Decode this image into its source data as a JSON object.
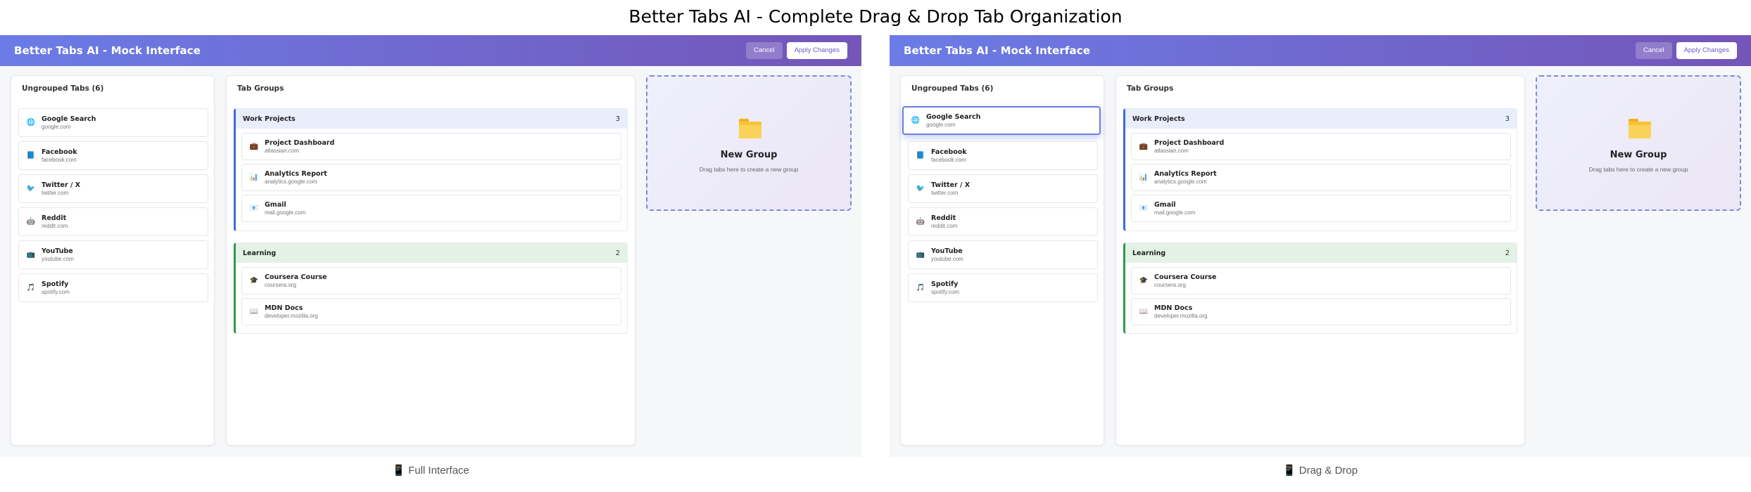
{
  "main_title": "Better Tabs AI - Complete Drag & Drop Tab Organization",
  "colors": {
    "header_start": "#6b7ce6",
    "header_end": "#7455b8",
    "work_group": "#3d6ad6",
    "learning_group": "#2f9a45",
    "drop_zone": "#7b8ae0"
  },
  "panels": [
    {
      "header": {
        "title": "Better Tabs AI - Mock Interface",
        "cancel_label": "Cancel",
        "apply_label": "Apply Changes"
      },
      "ungrouped": {
        "title": "Ungrouped Tabs (6)",
        "tabs": [
          {
            "name": "Google Search",
            "url": "google.com",
            "icon": "globe-icon",
            "glyph": "🌐"
          },
          {
            "name": "Facebook",
            "url": "facebook.com",
            "icon": "facebook-icon",
            "glyph": "📘"
          },
          {
            "name": "Twitter / X",
            "url": "twitter.com",
            "icon": "twitter-icon",
            "glyph": "🐦"
          },
          {
            "name": "Reddit",
            "url": "reddit.com",
            "icon": "reddit-icon",
            "glyph": "🤖"
          },
          {
            "name": "YouTube",
            "url": "youtube.com",
            "icon": "youtube-icon",
            "glyph": "📺"
          },
          {
            "name": "Spotify",
            "url": "spotify.com",
            "icon": "music-icon",
            "glyph": "🎵"
          }
        ]
      },
      "groups_title": "Tab Groups",
      "groups": [
        {
          "name": "Work Projects",
          "count": "3",
          "tabs": [
            {
              "name": "Project Dashboard",
              "url": "atlassian.com",
              "icon": "briefcase-icon",
              "glyph": "💼"
            },
            {
              "name": "Analytics Report",
              "url": "analytics.google.com",
              "icon": "chart-icon",
              "glyph": "📊"
            },
            {
              "name": "Gmail",
              "url": "mail.google.com",
              "icon": "mail-icon",
              "glyph": "📧"
            }
          ]
        },
        {
          "name": "Learning",
          "count": "2",
          "tabs": [
            {
              "name": "Coursera Course",
              "url": "coursera.org",
              "icon": "graduation-cap-icon",
              "glyph": "🎓"
            },
            {
              "name": "MDN Docs",
              "url": "developer.mozilla.org",
              "icon": "book-icon",
              "glyph": "📖"
            }
          ]
        }
      ],
      "new_group": {
        "title": "New Group",
        "subtitle": "Drag tabs here to create a new group"
      },
      "caption": "📱 Full Interface"
    },
    {
      "header": {
        "title": "Better Tabs AI - Mock Interface",
        "cancel_label": "Cancel",
        "apply_label": "Apply Changes"
      },
      "ungrouped": {
        "title": "Ungrouped Tabs (6)",
        "tabs": [
          {
            "name": "Google Search",
            "url": "google.com",
            "icon": "globe-icon",
            "glyph": "🌐",
            "dragging": true
          },
          {
            "name": "Facebook",
            "url": "facebook.com",
            "icon": "facebook-icon",
            "glyph": "📘"
          },
          {
            "name": "Twitter / X",
            "url": "twitter.com",
            "icon": "twitter-icon",
            "glyph": "🐦"
          },
          {
            "name": "Reddit",
            "url": "reddit.com",
            "icon": "reddit-icon",
            "glyph": "🤖"
          },
          {
            "name": "YouTube",
            "url": "youtube.com",
            "icon": "youtube-icon",
            "glyph": "📺"
          },
          {
            "name": "Spotify",
            "url": "spotify.com",
            "icon": "music-icon",
            "glyph": "🎵"
          }
        ]
      },
      "groups_title": "Tab Groups",
      "groups": [
        {
          "name": "Work Projects",
          "count": "3",
          "tabs": [
            {
              "name": "Project Dashboard",
              "url": "atlassian.com",
              "icon": "briefcase-icon",
              "glyph": "💼"
            },
            {
              "name": "Analytics Report",
              "url": "analytics.google.com",
              "icon": "chart-icon",
              "glyph": "📊"
            },
            {
              "name": "Gmail",
              "url": "mail.google.com",
              "icon": "mail-icon",
              "glyph": "📧"
            }
          ]
        },
        {
          "name": "Learning",
          "count": "2",
          "tabs": [
            {
              "name": "Coursera Course",
              "url": "coursera.org",
              "icon": "graduation-cap-icon",
              "glyph": "🎓"
            },
            {
              "name": "MDN Docs",
              "url": "developer.mozilla.org",
              "icon": "book-icon",
              "glyph": "📖"
            }
          ]
        }
      ],
      "new_group": {
        "title": "New Group",
        "subtitle": "Drag tabs here to create a new group"
      },
      "caption": "📱 Drag & Drop"
    }
  ]
}
